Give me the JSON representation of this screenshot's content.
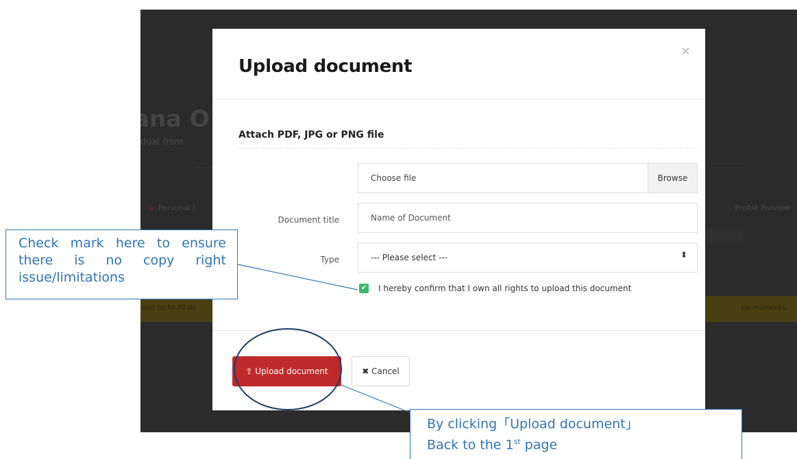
{
  "background": {
    "name_fragment": "ana O",
    "subtitle_fragment": "dual from",
    "nav_left": "Personal I",
    "nav_right": "Profile Preview",
    "banner_left": "oad up to 20 do",
    "banner_right": "ew moments."
  },
  "modal": {
    "title": "Upload document",
    "close_icon": "×",
    "section_label": "Attach PDF, JPG or PNG file",
    "file_input": {
      "value": "Choose file",
      "browse_label": "Browse"
    },
    "document_title": {
      "label": "Document title",
      "placeholder": "Name of Document"
    },
    "type": {
      "label": "Type",
      "selected": "--- Please select ---",
      "arrow": "⬍"
    },
    "confirm": {
      "checked": true,
      "label": "I hereby confirm that I own all rights to upload this document"
    },
    "upload_button": {
      "icon": "upload-icon",
      "label": "Upload document"
    },
    "cancel_button": {
      "icon": "times-icon",
      "label": "Cancel"
    }
  },
  "annotations": {
    "callout_1": "Check mark here to ensure there is no copy right issue/limitations",
    "callout_2_line1": "By clicking「Upload document」",
    "callout_2_line2_pre": "Back to the 1",
    "callout_2_line2_sup": "st",
    "callout_2_line2_post": " page",
    "color": "#2e75b6"
  },
  "colors": {
    "overlay": "#2b2b2b",
    "upload_button": "#be2a2a",
    "checkbox": "#3fb76b"
  }
}
